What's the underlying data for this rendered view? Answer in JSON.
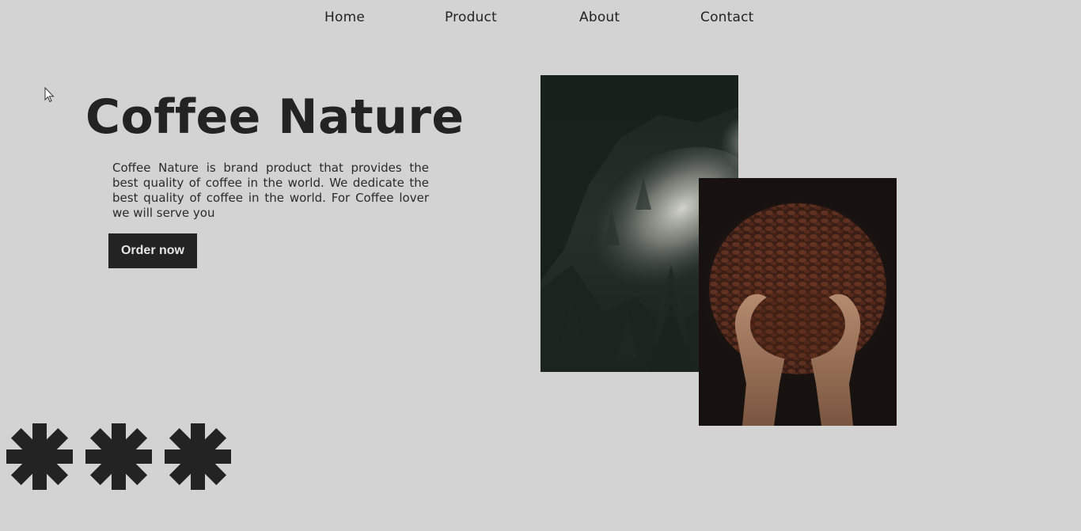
{
  "nav": {
    "items": [
      {
        "label": "Home"
      },
      {
        "label": "Product"
      },
      {
        "label": "About"
      },
      {
        "label": "Contact"
      }
    ]
  },
  "hero": {
    "title": "Coffee Nature",
    "description": "Coffee Nature is brand product that provides the best quality of coffee in the world. We dedicate the best quality of coffee in the world. For Coffee lover we will serve you",
    "cta_label": "Order now"
  },
  "images": {
    "forest": {
      "icon": "misty-forest-photo"
    },
    "beans": {
      "icon": "coffee-beans-in-hands-photo"
    }
  },
  "decoration": {
    "star_count": 3,
    "icon": "asterisk-icon"
  },
  "colors": {
    "background": "#d3d3d3",
    "text": "#232323",
    "button_bg": "#232323",
    "button_text": "#e6e6e6"
  }
}
